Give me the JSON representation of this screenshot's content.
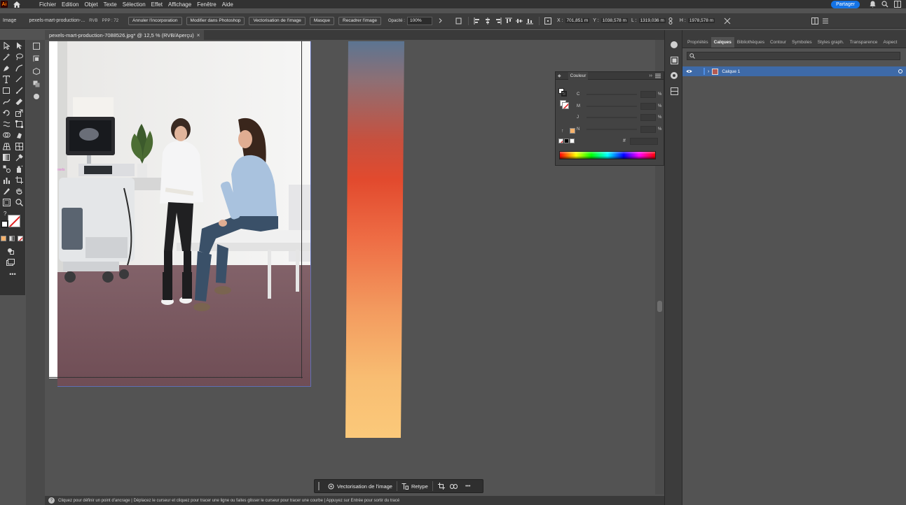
{
  "app": {
    "logo_text": "Ai",
    "menu": [
      "Fichier",
      "Edition",
      "Objet",
      "Texte",
      "Sélection",
      "Effet",
      "Affichage",
      "Fenêtre",
      "Aide"
    ],
    "share_label": "Partager"
  },
  "control_bar": {
    "selection_type": "Image",
    "file_link": "pexels-mart-production-...",
    "color_mode": "RVB",
    "ppi": "PPP : 72",
    "btn_cancel_embed": "Annuler l'incorporation",
    "btn_edit_photoshop": "Modifier dans Photoshop",
    "btn_vectorize": "Vectorisation de l'image",
    "btn_mask": "Masque",
    "btn_crop": "Recadrer l'image",
    "opacity_label": "Opacité :",
    "opacity_value": "100%",
    "x_label": "X :",
    "x_value": "701,851 m",
    "y_label": "Y :",
    "y_value": "1038,578 m",
    "w_label": "L :",
    "w_value": "1319,036 m",
    "h_label": "H :",
    "h_value": "1978,578 m"
  },
  "document": {
    "tab_title": "pexels-mart-production-7088526.jpg* @ 12,5 % (RVB/Aperçu)",
    "close_glyph": "×"
  },
  "color_panel": {
    "title": "Couleur",
    "channels": [
      "C",
      "M",
      "J",
      "N"
    ],
    "percent": "%",
    "swatch_color": "#f6b26b"
  },
  "right_panel": {
    "tabs": [
      "Propriétés",
      "Calques",
      "Bibliothèques",
      "Contour",
      "Symboles",
      "Styles graph.",
      "Transparence",
      "Aspect"
    ],
    "active_tab": "Calques",
    "layer_name": "Calque 1"
  },
  "taskbar": {
    "vectorize_label": "Vectorisation de l'image",
    "retype_label": "Retype",
    "more_glyph": "•••"
  },
  "status": {
    "help_glyph": "?",
    "hint": "Cliquez pour définir un point d'ancrage  |  Déplacez le curseur et cliquez pour tracer une ligne ou faites glisser le curseur pour tracer une courbe  |  Appuyez sur Entrée pour sortir du tracé"
  },
  "colors": {
    "accent": "#1473e6",
    "selected_layer": "#3e6aa8",
    "gradient": [
      "#5c7592",
      "#e24a2e",
      "#fbc97a"
    ]
  }
}
